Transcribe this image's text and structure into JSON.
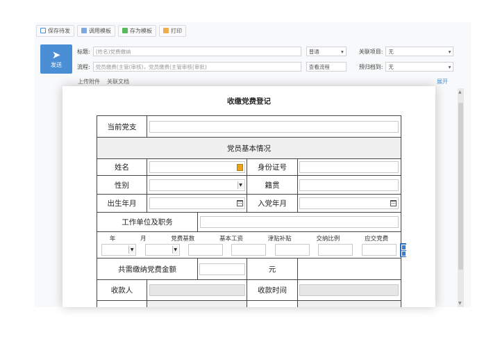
{
  "toolbar": {
    "save_pending": "保存待发",
    "use_template": "调用模板",
    "save_template": "存为模板",
    "print": "打印"
  },
  "send": {
    "label": "发送"
  },
  "header": {
    "title_label": "标题:",
    "title_value": "(姓名)党费缴纳",
    "flow_label": "流程:",
    "flow_value": "党员缴费(主管(审核)，党员缴费(主管审核(审批)",
    "priority_value": "普通",
    "view_flow": "查看流程",
    "related_label": "关联项目:",
    "related_value": "无",
    "archive_label": "预归档到:",
    "archive_value": "无"
  },
  "attachments": {
    "upload": "上传附件",
    "related_doc": "关联文档",
    "expand": "展开"
  },
  "document": {
    "title": "收缴党费登记",
    "rows": {
      "branch_label": "当前党支",
      "section_label": "党员基本情况",
      "name_label": "姓名",
      "id_label": "身份证号",
      "gender_label": "性别",
      "native_label": "籍贯",
      "birth_label": "出生年月",
      "join_label": "入党年月",
      "work_label": "工作单位及职务",
      "total_label": "共需缴纳党费金额",
      "yuan_label": "元",
      "receiver_label": "收款人",
      "receive_time_label": "收款时间"
    },
    "fee_columns": [
      "年",
      "月",
      "党费基数",
      "基本工资",
      "津贴补贴",
      "交纳比例",
      "应交党费"
    ]
  },
  "colors": {
    "accent": "#4a8fd6",
    "border": "#444444",
    "section_bg": "#f0f0f0"
  }
}
